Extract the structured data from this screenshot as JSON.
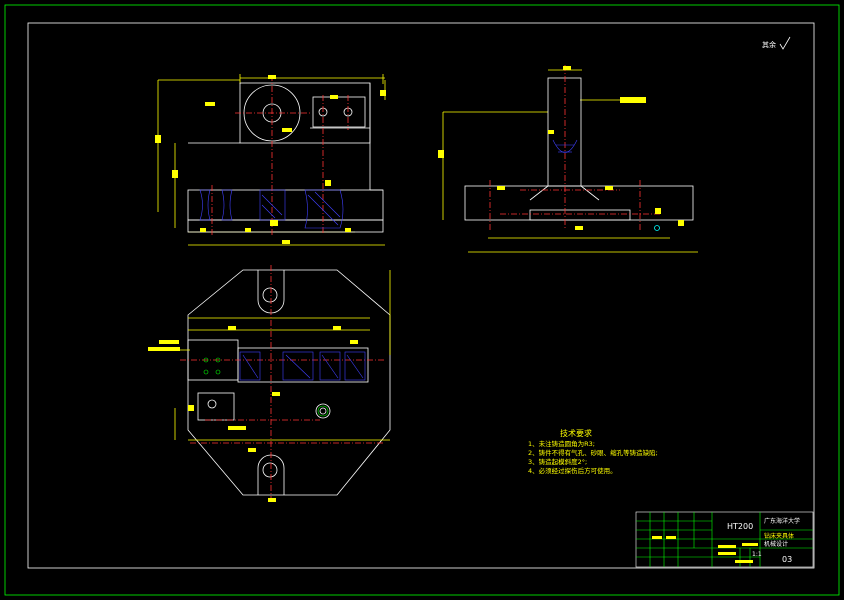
{
  "drawing": {
    "surface_mark": "其余",
    "notes_title": "技术要求",
    "notes": [
      "1、未注铸造圆角为R3;",
      "2、铸件不得有气孔、砂眼、缩孔等铸造缺陷;",
      "3、铸造起模斜度2°;",
      "4、必须经过探伤后方可使用。"
    ],
    "title_block": {
      "material": "HT200",
      "school": "广东海洋大学",
      "drawing_name": "钻床夹具体",
      "subtitle": "机械设计",
      "scale": "1:1",
      "sheet_number": "03"
    },
    "colors": {
      "background": "#000000",
      "frame": "#00ff00",
      "outline": "#ffffff",
      "dimension": "#ffff00",
      "centerline": "#ff3333",
      "hatch": "#4040ff",
      "text": "#ffff00",
      "accent_green": "#00ff00"
    }
  }
}
